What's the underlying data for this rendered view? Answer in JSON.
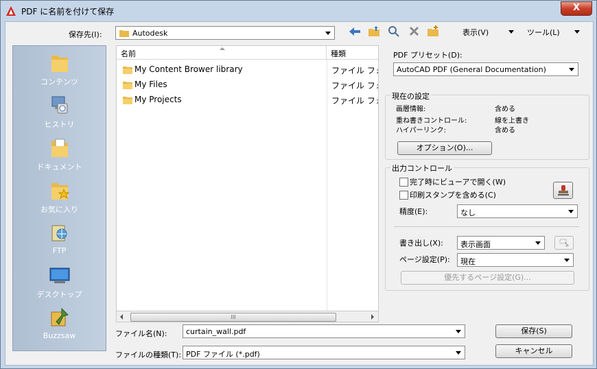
{
  "window": {
    "title": "PDF に名前を付けて保存",
    "close_label": "X"
  },
  "toolbar": {
    "save_in_label": "保存先(I):",
    "save_in_value": "Autodesk",
    "views_label": "表示(V)",
    "tools_label": "ツール(L)"
  },
  "places": [
    {
      "label": "コンテンツ",
      "icon": "folder-icon"
    },
    {
      "label": "ヒストリ",
      "icon": "history-icon"
    },
    {
      "label": "ドキュメント",
      "icon": "documents-icon"
    },
    {
      "label": "お気に入り",
      "icon": "favorites-icon"
    },
    {
      "label": "FTP",
      "icon": "ftp-icon"
    },
    {
      "label": "デスクトップ",
      "icon": "desktop-icon"
    },
    {
      "label": "Buzzsaw",
      "icon": "buzzsaw-icon"
    }
  ],
  "file_list": {
    "columns": [
      "名前",
      "種類"
    ],
    "rows": [
      {
        "name": "My Content Brower library",
        "type": "ファイル フォ"
      },
      {
        "name": "My Files",
        "type": "ファイル フォ"
      },
      {
        "name": "My Projects",
        "type": "ファイル フォ"
      }
    ],
    "scroll_grip": "III"
  },
  "footer": {
    "filename_label": "ファイル名(N):",
    "filename_value": "curtain_wall.pdf",
    "filetype_label": "ファイルの種類(T):",
    "filetype_value": "PDF ファイル (*.pdf)",
    "save_button": "保存(S)",
    "cancel_button": "キャンセル"
  },
  "pdf": {
    "preset_label": "PDF プリセット(D):",
    "preset_value": "AutoCAD PDF (General Documentation)",
    "current_settings": {
      "title": "現在の設定",
      "rows": [
        {
          "label": "画層情報:",
          "value": "含める"
        },
        {
          "label": "重ね書きコントロール:",
          "value": "線を上書き"
        },
        {
          "label": "ハイパーリンク:",
          "value": "含める"
        }
      ],
      "options_button": "オプション(O)..."
    },
    "output": {
      "title": "出力コントロール",
      "open_viewer": "完了時にビューアで開く(W)",
      "include_stamp": "印刷スタンプを含める(C)",
      "precision_label": "精度(E):",
      "precision_value": "なし",
      "export_label": "書き出し(X):",
      "export_value": "表示画面",
      "page_setup_label": "ページ設定(P):",
      "page_setup_value": "現在",
      "page_override_button": "優先するページ設定(G)..."
    }
  },
  "colors": {
    "accent": "#3c74c4",
    "places_bg": "#b8c8db",
    "close": "#c9402a"
  }
}
